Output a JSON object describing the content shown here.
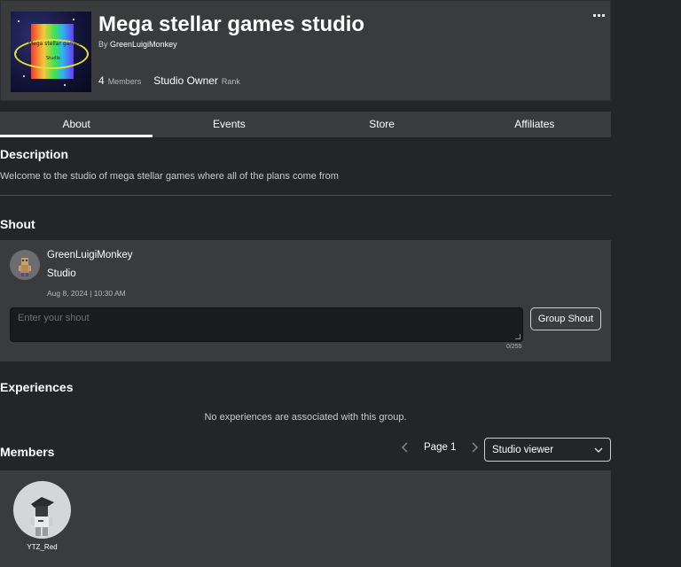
{
  "group": {
    "name": "Mega stellar games studio",
    "by_label": "By",
    "owner": "GreenLuigiMonkey",
    "member_count": "4",
    "members_label": "Members",
    "rank_value": "Studio Owner",
    "rank_label": "Rank",
    "logo_text_1": "Mega stellar games",
    "logo_text_2": "Studio"
  },
  "tabs": [
    {
      "label": "About",
      "active": true
    },
    {
      "label": "Events",
      "active": false
    },
    {
      "label": "Store",
      "active": false
    },
    {
      "label": "Affiliates",
      "active": false
    }
  ],
  "description": {
    "title": "Description",
    "text": "Welcome to the studio of mega stellar games where all of the plans come from"
  },
  "shout": {
    "title": "Shout",
    "user": "GreenLuigiMonkey",
    "body": "Studio",
    "date": "Aug 8, 2024 | 10:30 AM",
    "input_placeholder": "Enter your shout",
    "char_count": "0/255",
    "button_label": "Group Shout"
  },
  "experiences": {
    "title": "Experiences",
    "empty_text": "No experiences are associated with this group."
  },
  "members": {
    "title": "Members",
    "page_label": "Page 1",
    "role_selected": "Studio viewer",
    "list": [
      {
        "name": "YTZ_Red"
      }
    ]
  },
  "icons": {
    "more": "more-dots-icon",
    "prev": "chevron-left-icon",
    "next": "chevron-right-icon",
    "dropdown": "chevron-down-icon"
  }
}
